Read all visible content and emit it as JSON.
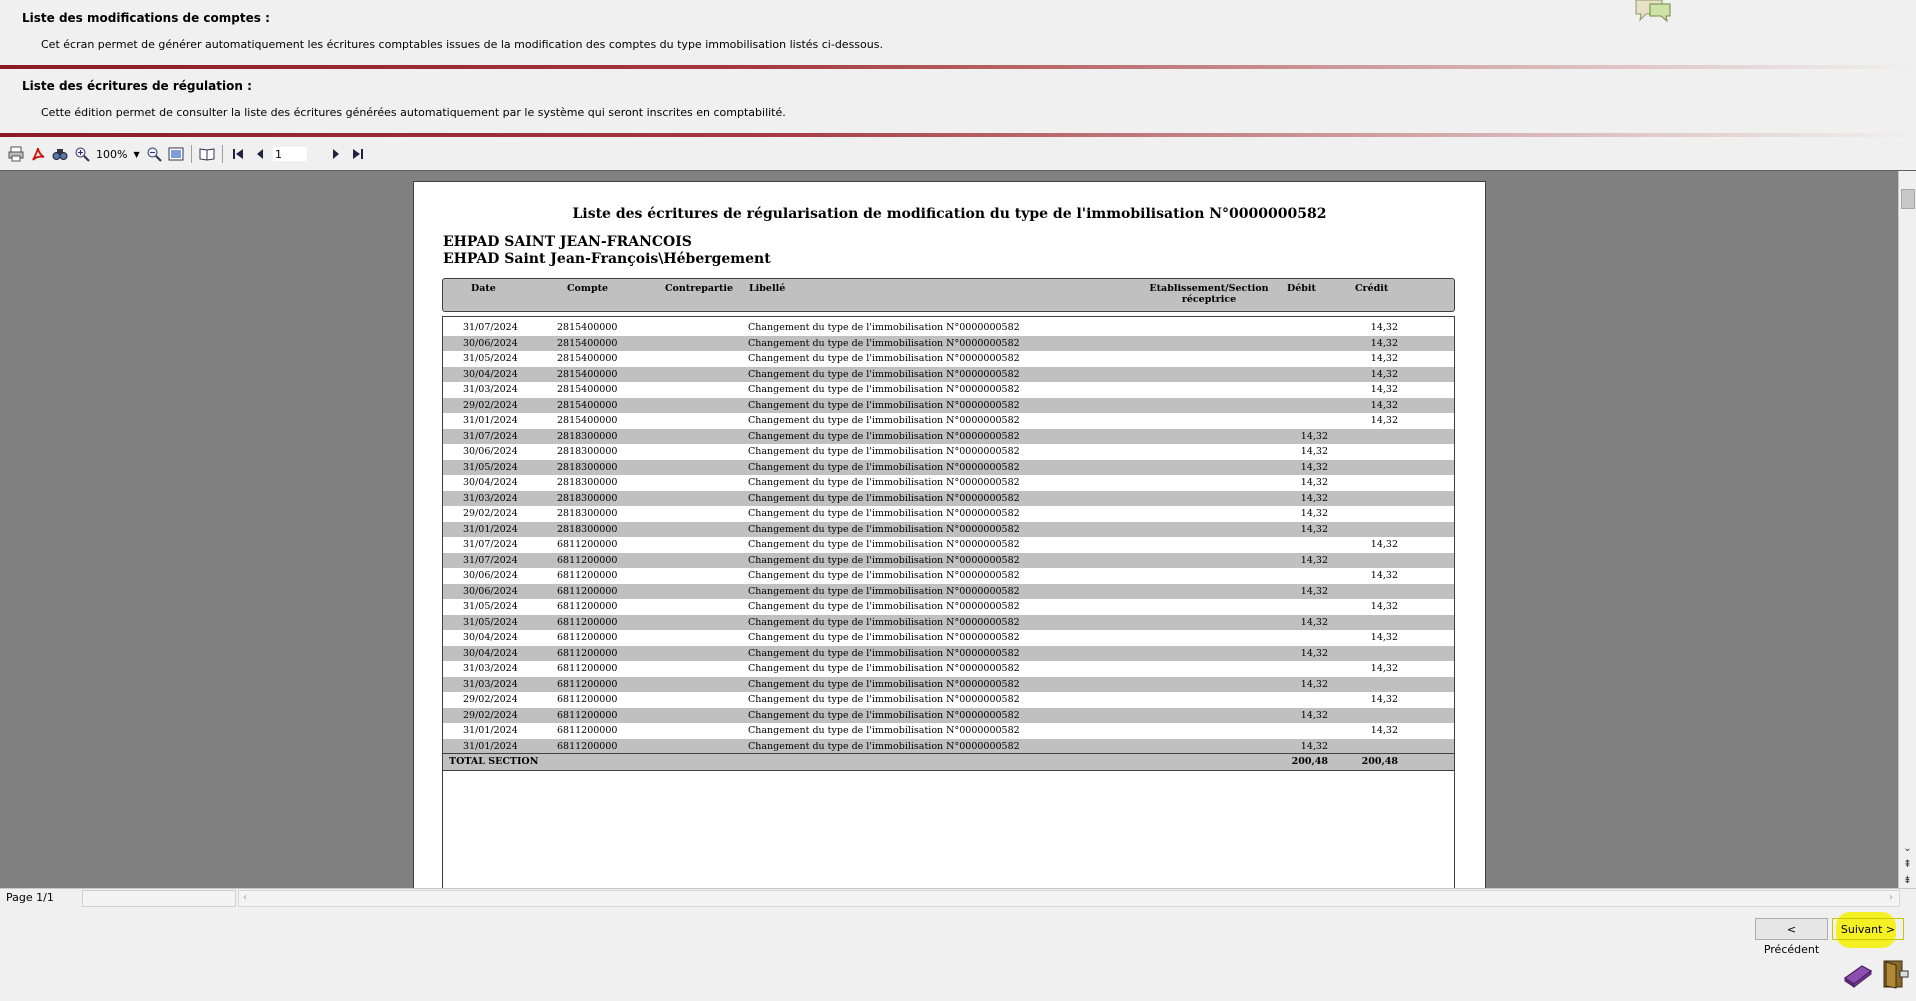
{
  "section1": {
    "title": "Liste des modifications de comptes :",
    "description": "Cet écran permet de générer automatiquement les écritures comptables issues de la modification des comptes du type immobilisation listés ci-dessous."
  },
  "section2": {
    "title": "Liste des écritures de régulation :",
    "description": "Cette édition permet de consulter la liste des écritures générées automatiquement par le système qui seront inscrites en comptabilité."
  },
  "toolbar": {
    "zoom": "100%",
    "page_number": "1",
    "icons": [
      "print-icon",
      "pdf-icon",
      "find-icon",
      "zoom-in-icon",
      "zoom-out-icon",
      "fit-page-icon",
      "book-icon",
      "first-page-icon",
      "prev-page-icon",
      "next-page-icon",
      "last-page-icon"
    ]
  },
  "report": {
    "title": "Liste des écritures de régularisation de modification du type de l'immobilisation N°0000000582",
    "establishment": "EHPAD SAINT JEAN-FRANCOIS",
    "section": "EHPAD Saint Jean-François\\Hébergement",
    "headers": {
      "date": "Date",
      "compte": "Compte",
      "contrepartie": "Contrepartie",
      "libelle": "Libellé",
      "etab_line1": "Etablissement/Section",
      "etab_line2": "réceptrice",
      "debit": "Débit",
      "credit": "Crédit"
    },
    "rows": [
      {
        "date": "31/07/2024",
        "compte": "2815400000",
        "libelle": "Changement du type de l'immobilisation N°0000000582",
        "debit": "",
        "credit": "14,32"
      },
      {
        "date": "30/06/2024",
        "compte": "2815400000",
        "libelle": "Changement du type de l'immobilisation N°0000000582",
        "debit": "",
        "credit": "14,32"
      },
      {
        "date": "31/05/2024",
        "compte": "2815400000",
        "libelle": "Changement du type de l'immobilisation N°0000000582",
        "debit": "",
        "credit": "14,32"
      },
      {
        "date": "30/04/2024",
        "compte": "2815400000",
        "libelle": "Changement du type de l'immobilisation N°0000000582",
        "debit": "",
        "credit": "14,32"
      },
      {
        "date": "31/03/2024",
        "compte": "2815400000",
        "libelle": "Changement du type de l'immobilisation N°0000000582",
        "debit": "",
        "credit": "14,32"
      },
      {
        "date": "29/02/2024",
        "compte": "2815400000",
        "libelle": "Changement du type de l'immobilisation N°0000000582",
        "debit": "",
        "credit": "14,32"
      },
      {
        "date": "31/01/2024",
        "compte": "2815400000",
        "libelle": "Changement du type de l'immobilisation N°0000000582",
        "debit": "",
        "credit": "14,32"
      },
      {
        "date": "31/07/2024",
        "compte": "2818300000",
        "libelle": "Changement du type de l'immobilisation N°0000000582",
        "debit": "14,32",
        "credit": ""
      },
      {
        "date": "30/06/2024",
        "compte": "2818300000",
        "libelle": "Changement du type de l'immobilisation N°0000000582",
        "debit": "14,32",
        "credit": ""
      },
      {
        "date": "31/05/2024",
        "compte": "2818300000",
        "libelle": "Changement du type de l'immobilisation N°0000000582",
        "debit": "14,32",
        "credit": ""
      },
      {
        "date": "30/04/2024",
        "compte": "2818300000",
        "libelle": "Changement du type de l'immobilisation N°0000000582",
        "debit": "14,32",
        "credit": ""
      },
      {
        "date": "31/03/2024",
        "compte": "2818300000",
        "libelle": "Changement du type de l'immobilisation N°0000000582",
        "debit": "14,32",
        "credit": ""
      },
      {
        "date": "29/02/2024",
        "compte": "2818300000",
        "libelle": "Changement du type de l'immobilisation N°0000000582",
        "debit": "14,32",
        "credit": ""
      },
      {
        "date": "31/01/2024",
        "compte": "2818300000",
        "libelle": "Changement du type de l'immobilisation N°0000000582",
        "debit": "14,32",
        "credit": ""
      },
      {
        "date": "31/07/2024",
        "compte": "6811200000",
        "libelle": "Changement du type de l'immobilisation N°0000000582",
        "debit": "",
        "credit": "14,32"
      },
      {
        "date": "31/07/2024",
        "compte": "6811200000",
        "libelle": "Changement du type de l'immobilisation N°0000000582",
        "debit": "14,32",
        "credit": ""
      },
      {
        "date": "30/06/2024",
        "compte": "6811200000",
        "libelle": "Changement du type de l'immobilisation N°0000000582",
        "debit": "",
        "credit": "14,32"
      },
      {
        "date": "30/06/2024",
        "compte": "6811200000",
        "libelle": "Changement du type de l'immobilisation N°0000000582",
        "debit": "14,32",
        "credit": ""
      },
      {
        "date": "31/05/2024",
        "compte": "6811200000",
        "libelle": "Changement du type de l'immobilisation N°0000000582",
        "debit": "",
        "credit": "14,32"
      },
      {
        "date": "31/05/2024",
        "compte": "6811200000",
        "libelle": "Changement du type de l'immobilisation N°0000000582",
        "debit": "14,32",
        "credit": ""
      },
      {
        "date": "30/04/2024",
        "compte": "6811200000",
        "libelle": "Changement du type de l'immobilisation N°0000000582",
        "debit": "",
        "credit": "14,32"
      },
      {
        "date": "30/04/2024",
        "compte": "6811200000",
        "libelle": "Changement du type de l'immobilisation N°0000000582",
        "debit": "14,32",
        "credit": ""
      },
      {
        "date": "31/03/2024",
        "compte": "6811200000",
        "libelle": "Changement du type de l'immobilisation N°0000000582",
        "debit": "",
        "credit": "14,32"
      },
      {
        "date": "31/03/2024",
        "compte": "6811200000",
        "libelle": "Changement du type de l'immobilisation N°0000000582",
        "debit": "14,32",
        "credit": ""
      },
      {
        "date": "29/02/2024",
        "compte": "6811200000",
        "libelle": "Changement du type de l'immobilisation N°0000000582",
        "debit": "",
        "credit": "14,32"
      },
      {
        "date": "29/02/2024",
        "compte": "6811200000",
        "libelle": "Changement du type de l'immobilisation N°0000000582",
        "debit": "14,32",
        "credit": ""
      },
      {
        "date": "31/01/2024",
        "compte": "6811200000",
        "libelle": "Changement du type de l'immobilisation N°0000000582",
        "debit": "",
        "credit": "14,32"
      },
      {
        "date": "31/01/2024",
        "compte": "6811200000",
        "libelle": "Changement du type de l'immobilisation N°0000000582",
        "debit": "14,32",
        "credit": ""
      }
    ],
    "total": {
      "label": "TOTAL SECTION",
      "debit": "200,48",
      "credit": "200,48"
    }
  },
  "statusbar": {
    "page_label": "Page 1/1"
  },
  "nav": {
    "prev_label": "< Précédent",
    "next_label": "Suivant >"
  },
  "colors": {
    "separator": "#8b1c24",
    "viewer_bg": "#808080",
    "row_alt": "#c0c0c0",
    "highlight": "#f4f000"
  }
}
